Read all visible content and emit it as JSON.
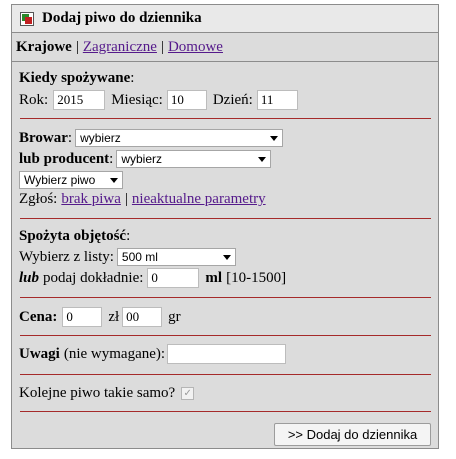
{
  "header": {
    "title": "Dodaj piwo do dziennika",
    "icon": "add-beer-icon"
  },
  "tabs": [
    {
      "label": "Krajowe",
      "active": true
    },
    {
      "label": "Zagraniczne",
      "active": false
    },
    {
      "label": "Domowe",
      "active": false
    }
  ],
  "tab_separator": "|",
  "when": {
    "heading": "Kiedy spożywane",
    "colon": ":",
    "year_label": "Rok:",
    "year_value": "2015",
    "month_label": "Miesiąc:",
    "month_value": "10",
    "day_label": "Dzień:",
    "day_value": "11"
  },
  "brewery": {
    "brewery_label": "Browar",
    "brewery_value": "wybierz",
    "producer_label": "lub producent",
    "producer_value": "wybierz",
    "beer_value": "Wybierz piwo",
    "report_label": "Zgłoś:",
    "report_missing": "brak piwa",
    "report_sep": "|",
    "report_outdated": "nieaktualne parametry"
  },
  "volume": {
    "heading": "Spożyta objętość",
    "heading_suffix": " :",
    "list_label": "Wybierz z listy:",
    "list_value": "500 ml",
    "exact_or": "lub",
    "exact_label": "podaj dokładnie:",
    "exact_value": "0",
    "unit": "ml",
    "range": "[10-1500]"
  },
  "price": {
    "label": "Cena:",
    "zl_value": "0",
    "zl_unit": "zł",
    "gr_value": "00",
    "gr_unit": "gr"
  },
  "notes": {
    "label": "Uwagi",
    "hint": "(nie wymagane):",
    "value": ""
  },
  "repeat": {
    "label": "Kolejne piwo takie samo?",
    "checked": true
  },
  "submit": {
    "label": ">>  Dodaj do dziennika"
  },
  "colors": {
    "divider": "#a52a2a",
    "link": "#551a8b",
    "panel": "#dcdcdc"
  }
}
